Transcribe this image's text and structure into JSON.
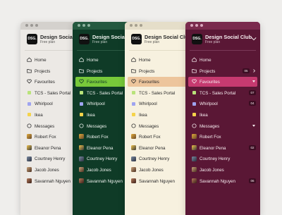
{
  "brand": {
    "logo": "DSG.",
    "name": "Design Social Club",
    "plan": "Free plan"
  },
  "nav": {
    "home": "Home",
    "projects": "Projects",
    "favourites": "Favourites",
    "fav_items": [
      "TCS - Sales Portal",
      "Whirlpool",
      "Ikea"
    ],
    "messages": "Messages",
    "contacts": [
      "Robert Fox",
      "Eleanor Pena",
      "Courtney Henry",
      "Jacob Jones",
      "Savannah Nguyen"
    ]
  },
  "badges": {
    "panel3": {
      "projects": "05"
    },
    "panel4": {
      "projects": "05",
      "tcs": "07",
      "whirlpool": "04",
      "eleanor": "02",
      "savannah": "06"
    }
  },
  "colors": {
    "themes": [
      "#ece9e5",
      "#0f3b27",
      "#f7f1df",
      "#5a1735"
    ],
    "selected": [
      "none",
      "#78c93a",
      "#edc59c",
      "#c63a70"
    ],
    "tag_colors": {
      "tcs": "#b9e37a",
      "whirlpool": "#9fa4f0",
      "ikea": "#f5d34a"
    }
  },
  "icons": {
    "home": "home-icon",
    "projects": "folder-icon",
    "favourites": "heart-icon",
    "messages": "chat-icon",
    "collapse": "chevron-down-icon"
  }
}
